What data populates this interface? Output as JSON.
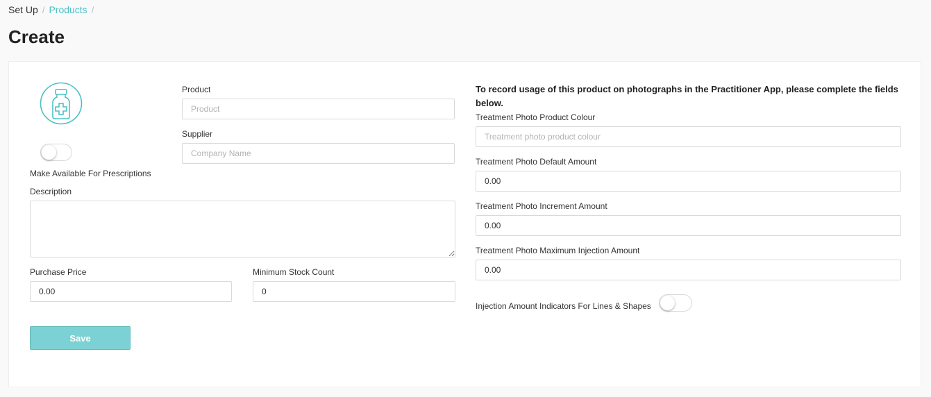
{
  "breadcrumb": {
    "root": "Set Up",
    "separator": "/",
    "current": "Products"
  },
  "page": {
    "title": "Create"
  },
  "colors": {
    "accent": "#4ac1c7",
    "save_button": "#7bd1d3",
    "icon_stroke": "#4ac1c7"
  },
  "icon": {
    "name": "medicine-bottle-icon"
  },
  "form": {
    "product": {
      "label": "Product",
      "placeholder": "Product",
      "value": ""
    },
    "supplier": {
      "label": "Supplier",
      "placeholder": "Company Name",
      "value": ""
    },
    "prescriptions_toggle": {
      "label": "Make Available For Prescriptions",
      "on": false
    },
    "description": {
      "label": "Description",
      "value": ""
    },
    "purchase_price": {
      "label": "Purchase Price",
      "value": "0.00"
    },
    "min_stock": {
      "label": "Minimum Stock Count",
      "value": "0"
    },
    "save_label": "Save"
  },
  "treatment": {
    "notice": "To record usage of this product on photographs in the Practitioner App, please complete the fields below.",
    "colour": {
      "label": "Treatment Photo Product Colour",
      "placeholder": "Treatment photo product colour",
      "value": ""
    },
    "default_amount": {
      "label": "Treatment Photo Default Amount",
      "value": "0.00"
    },
    "increment_amount": {
      "label": "Treatment Photo Increment Amount",
      "value": "0.00"
    },
    "max_injection": {
      "label": "Treatment Photo Maximum Injection Amount",
      "value": "0.00"
    },
    "indicators_toggle": {
      "label": "Injection Amount Indicators For Lines & Shapes",
      "on": false
    }
  }
}
